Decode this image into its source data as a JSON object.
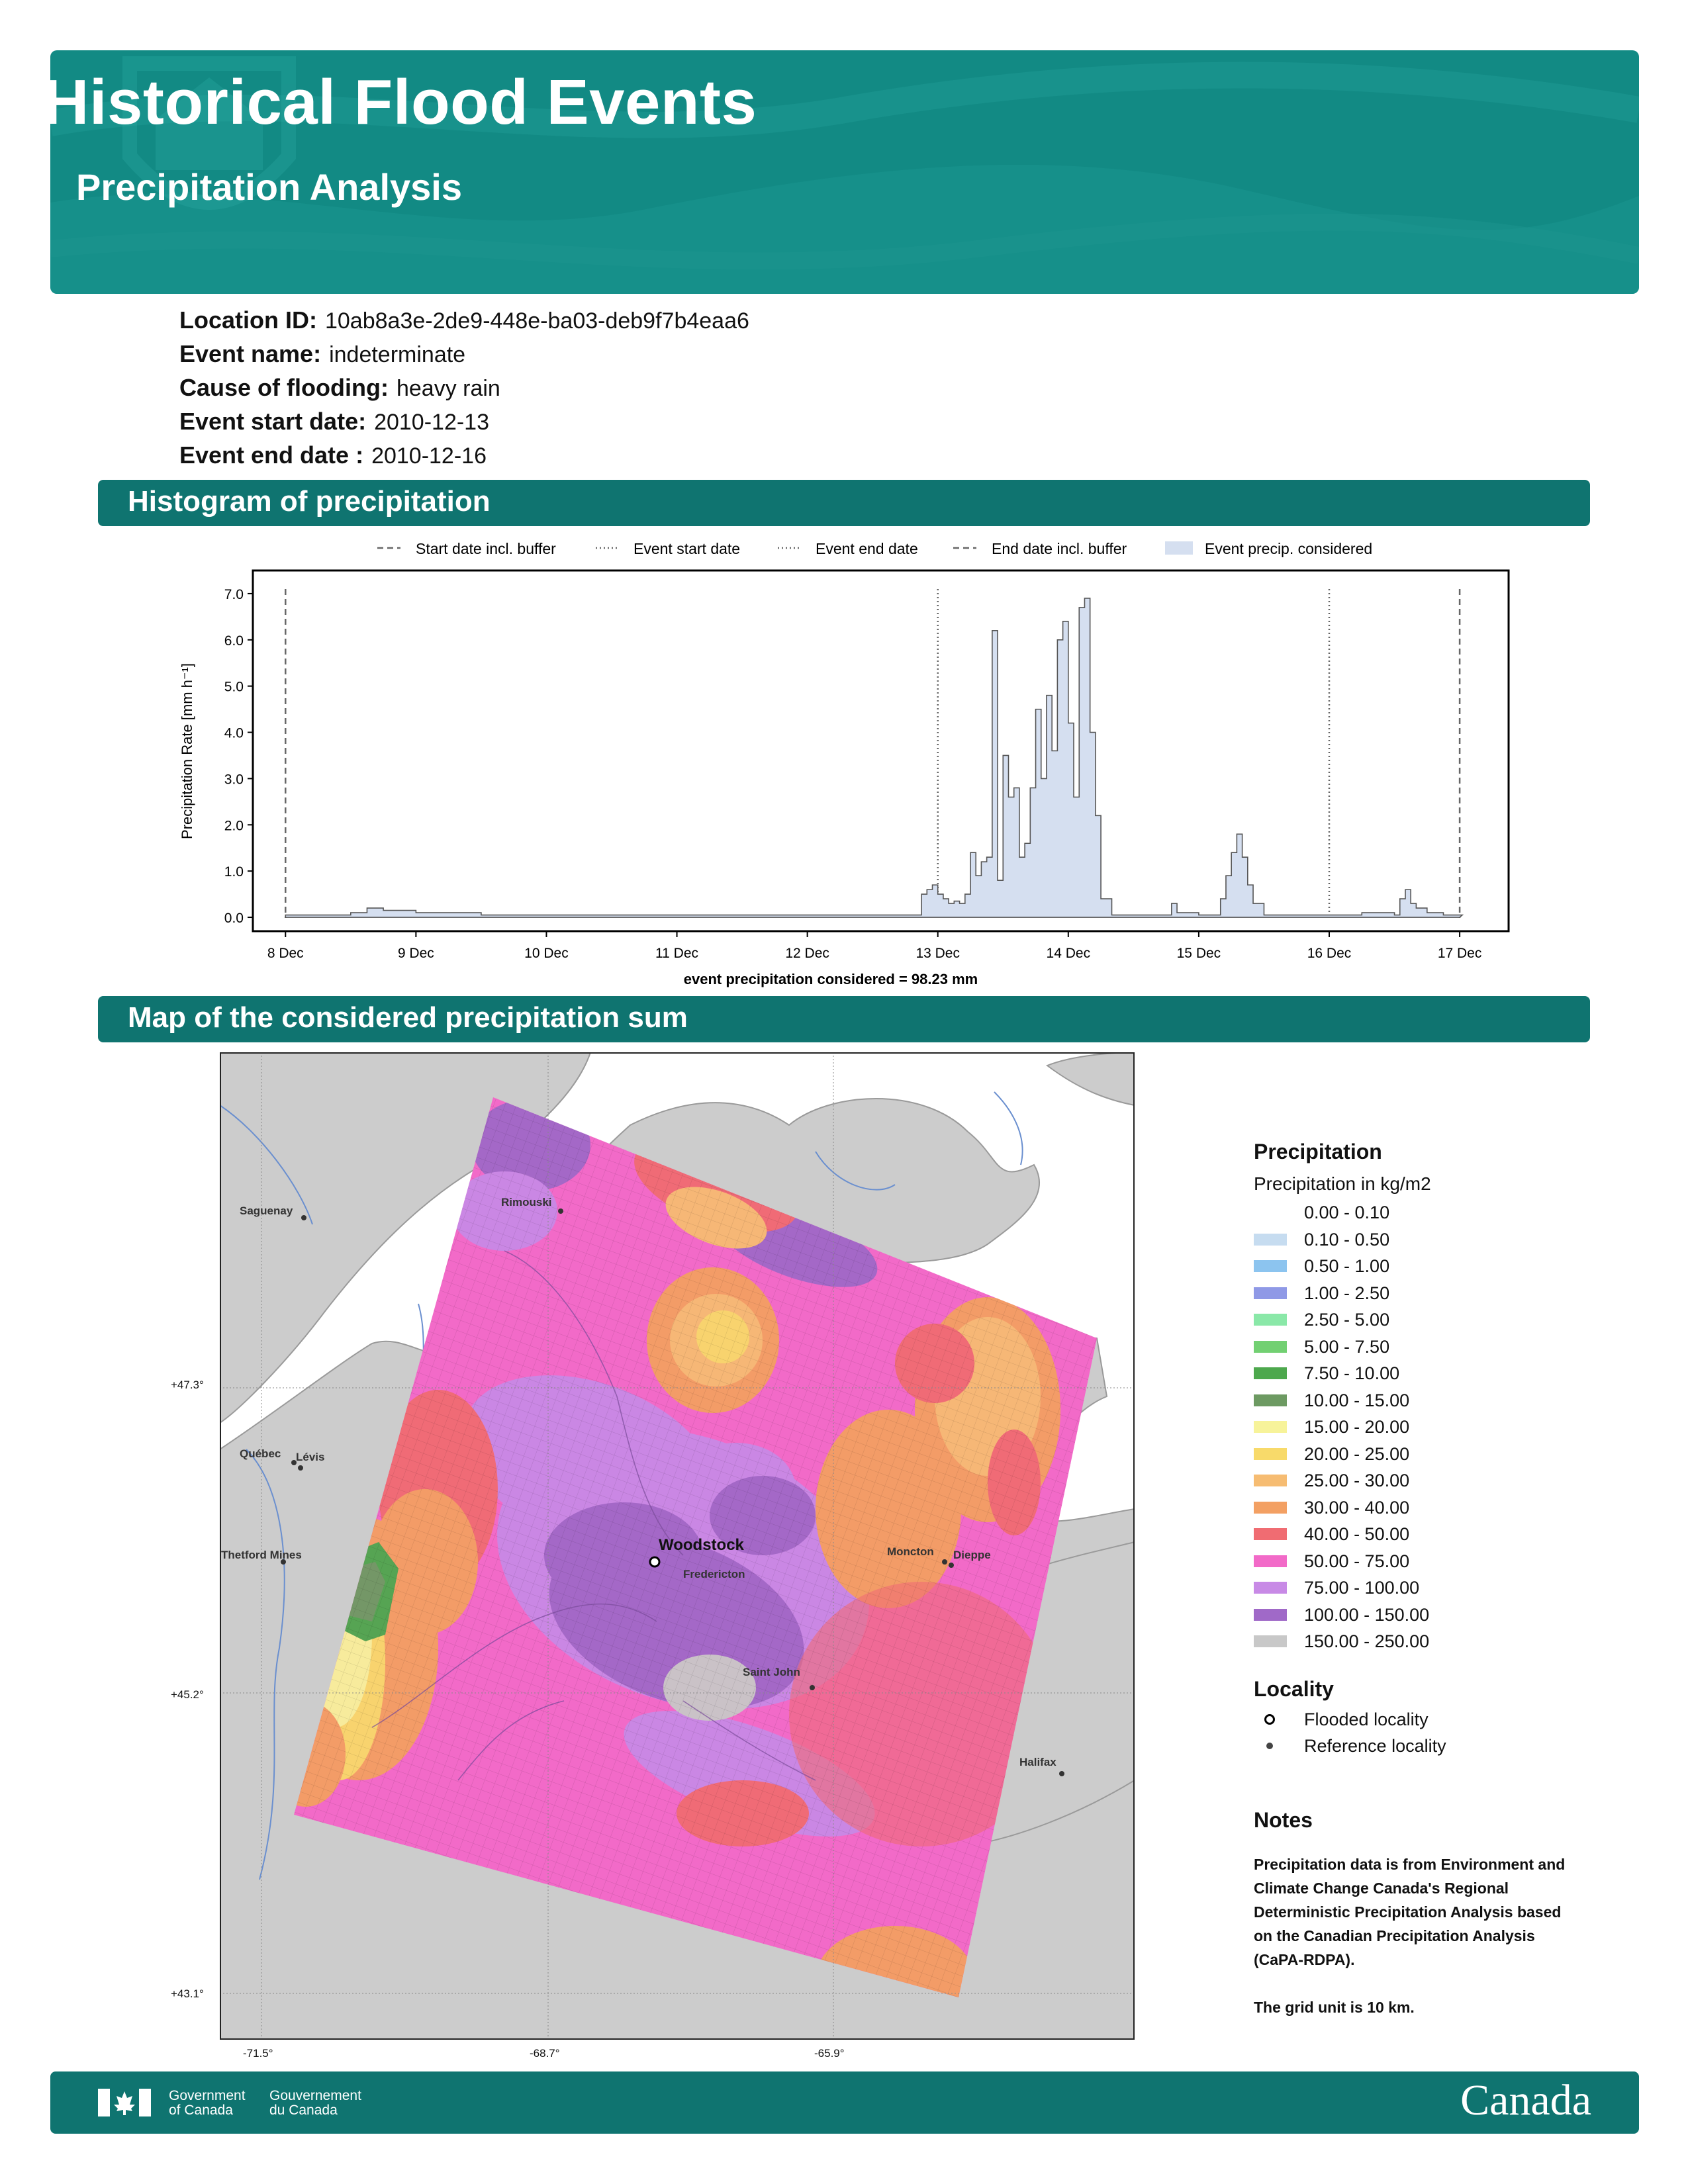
{
  "header": {
    "title": "Historical Flood Events",
    "subtitle": "Precipitation Analysis"
  },
  "info": [
    {
      "label": "Location ID:",
      "value": "10ab8a3e-2de9-448e-ba03-deb9f7b4eaa6"
    },
    {
      "label": "Event name:",
      "value": "indeterminate"
    },
    {
      "label": "Cause of flooding:",
      "value": "heavy rain"
    },
    {
      "label": "Event start date:",
      "value": "2010-12-13"
    },
    {
      "label": "Event end date :",
      "value": "2010-12-16"
    }
  ],
  "sections": {
    "histogram": "Histogram of precipitation",
    "map": "Map of the considered precipitation sum"
  },
  "chart_data": {
    "type": "area",
    "title": "",
    "ylabel": "Precipitation Rate [mm h⁻¹]",
    "xlabel": "event precipitation considered = 98.23 mm",
    "ylim": [
      -0.3,
      7.5
    ],
    "xlim": [
      "2010-12-07T18:00",
      "2010-12-17T09:00"
    ],
    "yticks": [
      "0.0",
      "1.0",
      "2.0",
      "3.0",
      "4.0",
      "5.0",
      "6.0",
      "7.0"
    ],
    "xticks": [
      "8 Dec",
      "9 Dec",
      "10 Dec",
      "11 Dec",
      "12 Dec",
      "13 Dec",
      "14 Dec",
      "15 Dec",
      "16 Dec",
      "17 Dec"
    ],
    "legend": [
      "Start date incl. buffer",
      "Event start date",
      "Event end date",
      "End date incl. buffer",
      "Event precip. considered"
    ],
    "legend_position": "top",
    "markers": {
      "start_buffer": "2010-12-08T00:00",
      "event_start": "2010-12-13T00:00",
      "event_end": "2010-12-16T00:00",
      "end_buffer": "2010-12-17T00:00"
    },
    "series": [
      {
        "x": [
          "2010-12-08T00:00",
          "2010-12-08T12:00",
          "2010-12-08T15:00",
          "2010-12-08T18:00",
          "2010-12-09T00:00",
          "2010-12-09T12:00",
          "2010-12-10T00:00",
          "2010-12-11T00:00",
          "2010-12-12T00:00",
          "2010-12-12T12:00",
          "2010-12-12T20:00",
          "2010-12-12T21:00",
          "2010-12-12T22:00",
          "2010-12-12T23:00",
          "2010-12-13T00:00",
          "2010-12-13T01:00",
          "2010-12-13T02:00",
          "2010-12-13T03:00",
          "2010-12-13T04:00",
          "2010-12-13T05:00",
          "2010-12-13T06:00",
          "2010-12-13T07:00",
          "2010-12-13T08:00",
          "2010-12-13T09:00",
          "2010-12-13T10:00",
          "2010-12-13T11:00",
          "2010-12-13T12:00",
          "2010-12-13T13:00",
          "2010-12-13T14:00",
          "2010-12-13T15:00",
          "2010-12-13T16:00",
          "2010-12-13T17:00",
          "2010-12-13T18:00",
          "2010-12-13T19:00",
          "2010-12-13T20:00",
          "2010-12-13T21:00",
          "2010-12-13T22:00",
          "2010-12-13T23:00",
          "2010-12-14T00:00",
          "2010-12-14T01:00",
          "2010-12-14T02:00",
          "2010-12-14T03:00",
          "2010-12-14T04:00",
          "2010-12-14T05:00",
          "2010-12-14T06:00",
          "2010-12-14T08:00",
          "2010-12-14T12:00",
          "2010-12-14T18:00",
          "2010-12-14T19:00",
          "2010-12-14T20:00",
          "2010-12-15T00:00",
          "2010-12-15T04:00",
          "2010-12-15T05:00",
          "2010-12-15T06:00",
          "2010-12-15T07:00",
          "2010-12-15T08:00",
          "2010-12-15T09:00",
          "2010-12-15T10:00",
          "2010-12-15T12:00",
          "2010-12-16T00:00",
          "2010-12-16T06:00",
          "2010-12-16T12:00",
          "2010-12-16T13:00",
          "2010-12-16T14:00",
          "2010-12-16T15:00",
          "2010-12-16T16:00",
          "2010-12-16T18:00",
          "2010-12-16T21:00",
          "2010-12-17T00:00"
        ],
        "values": [
          0.05,
          0.1,
          0.2,
          0.15,
          0.1,
          0.05,
          0.05,
          0.05,
          0.05,
          0.05,
          0.05,
          0.5,
          0.6,
          0.7,
          0.5,
          0.4,
          0.3,
          0.35,
          0.3,
          0.5,
          1.4,
          0.9,
          1.2,
          1.3,
          6.2,
          0.8,
          3.5,
          2.6,
          2.8,
          1.3,
          1.6,
          2.8,
          4.5,
          3.0,
          4.8,
          3.6,
          6.0,
          6.4,
          4.2,
          2.6,
          6.7,
          6.9,
          4.0,
          2.2,
          0.4,
          0.05,
          0.05,
          0.05,
          0.3,
          0.1,
          0.05,
          0.4,
          0.9,
          1.4,
          1.8,
          1.3,
          0.7,
          0.3,
          0.05,
          0.05,
          0.1,
          0.05,
          0.4,
          0.6,
          0.3,
          0.2,
          0.1,
          0.05,
          0.05
        ]
      }
    ]
  },
  "map": {
    "lat_labels": [
      "+47.3°",
      "+45.2°",
      "+43.1°"
    ],
    "lon_labels": [
      "-71.5°",
      "-68.7°",
      "-65.9°"
    ],
    "places": [
      {
        "name": "Saguenay",
        "type": "reference"
      },
      {
        "name": "Rimouski",
        "type": "reference"
      },
      {
        "name": "Québec",
        "type": "reference"
      },
      {
        "name": "Lévis",
        "type": "reference"
      },
      {
        "name": "Thetford Mines",
        "type": "reference"
      },
      {
        "name": "Woodstock",
        "type": "flooded"
      },
      {
        "name": "Fredericton",
        "type": "reference"
      },
      {
        "name": "Moncton",
        "type": "reference"
      },
      {
        "name": "Dieppe",
        "type": "reference"
      },
      {
        "name": "Saint John",
        "type": "reference"
      },
      {
        "name": "Halifax",
        "type": "reference"
      }
    ]
  },
  "legend": {
    "title": "Precipitation",
    "subtitle": "Precipitation in kg/m2",
    "items": [
      {
        "label": "0.00 - 0.10",
        "color": "#ffffff"
      },
      {
        "label": "0.10 - 0.50",
        "color": "#c6dcf0"
      },
      {
        "label": "0.50 - 1.00",
        "color": "#8cc4ef"
      },
      {
        "label": "1.00 - 2.50",
        "color": "#8f99e6"
      },
      {
        "label": "2.50 - 5.00",
        "color": "#8ae8a8"
      },
      {
        "label": "5.00 - 7.50",
        "color": "#72d072"
      },
      {
        "label": "7.50 - 10.00",
        "color": "#4da84d"
      },
      {
        "label": "10.00 - 15.00",
        "color": "#6d9a62"
      },
      {
        "label": "15.00 - 20.00",
        "color": "#f7f39a"
      },
      {
        "label": "20.00 - 25.00",
        "color": "#f8da6a"
      },
      {
        "label": "25.00 - 30.00",
        "color": "#f6bc72"
      },
      {
        "label": "30.00 - 40.00",
        "color": "#f3a063"
      },
      {
        "label": "40.00 - 50.00",
        "color": "#f06c72"
      },
      {
        "label": "50.00 - 75.00",
        "color": "#f26ac8"
      },
      {
        "label": "75.00 - 100.00",
        "color": "#c88ae6"
      },
      {
        "label": "100.00 - 150.00",
        "color": "#a069c8"
      },
      {
        "label": "150.00 - 250.00",
        "color": "#c8c8c8"
      }
    ],
    "locality_title": "Locality",
    "locality_items": [
      {
        "label": "Flooded locality",
        "icon": "open-circle-icon"
      },
      {
        "label": "Reference locality",
        "icon": "dot-icon"
      }
    ]
  },
  "notes": {
    "title": "Notes",
    "lines": [
      "Precipitation data is from Environment and",
      "Climate Change Canada's Regional",
      "Deterministic Precipitation Analysis based",
      "on the Canadian Precipitation Analysis",
      "(CaPA-RDPA).",
      "",
      "The grid unit is 10 km."
    ]
  },
  "footer": {
    "gov_en": [
      "Government",
      "of Canada"
    ],
    "gov_fr": [
      "Gouvernement",
      "du Canada"
    ],
    "wordmark": "Canada"
  },
  "colors": {
    "header_bg": "#128a84",
    "section_bg": "#0f7470",
    "hist_fill": "#d5dff0"
  }
}
